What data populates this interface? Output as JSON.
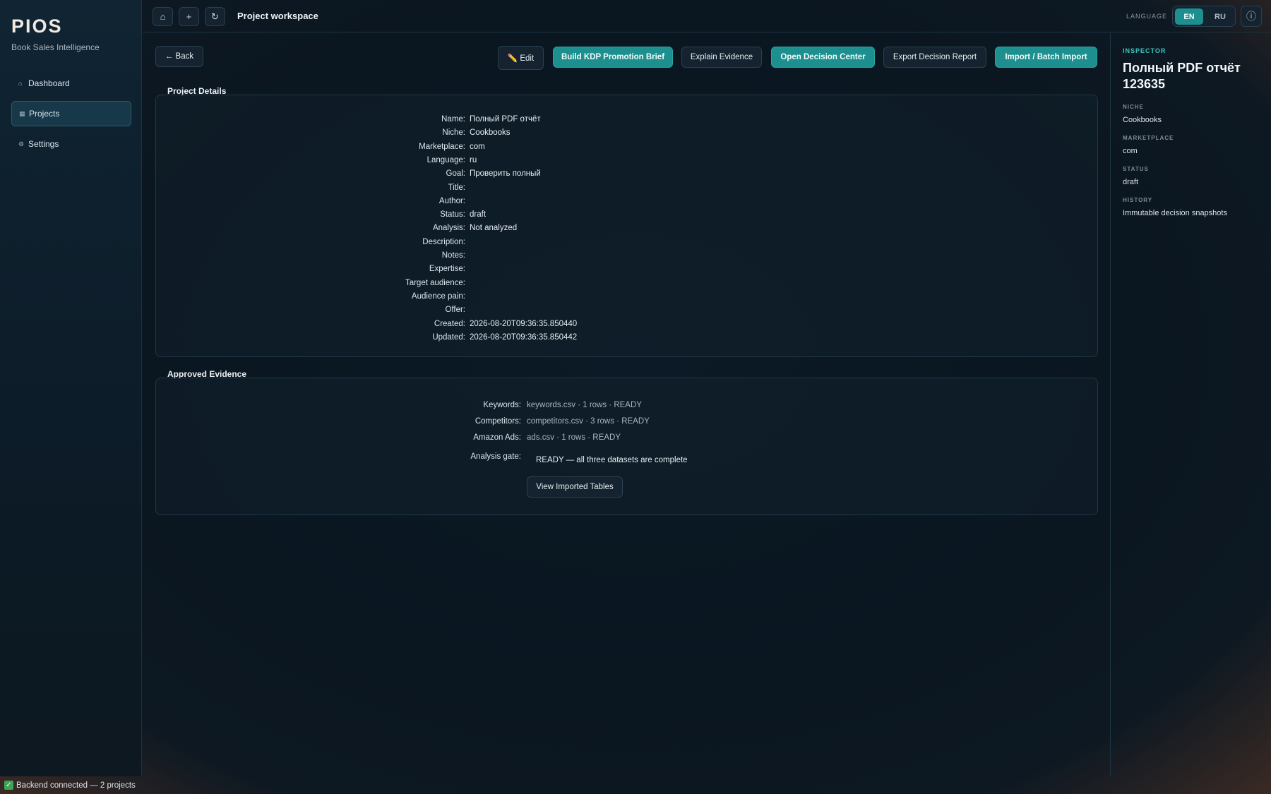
{
  "app": {
    "brand": "PIOS",
    "subtitle": "Book Sales Intelligence"
  },
  "sidebar": {
    "items": [
      {
        "label": "Dashboard",
        "icon": "house-icon",
        "glyph": "⌂"
      },
      {
        "label": "Projects",
        "icon": "grid-icon",
        "glyph": "▦"
      },
      {
        "label": "Settings",
        "icon": "gear-icon",
        "glyph": "⚙"
      }
    ]
  },
  "topbar": {
    "home_glyph": "⌂",
    "add_glyph": "+",
    "refresh_glyph": "↻",
    "title": "Project workspace",
    "language_label": "LANGUAGE",
    "lang_en": "EN",
    "lang_ru": "RU",
    "info_glyph": "ⓘ"
  },
  "toolbar": {
    "back": "← Back",
    "edit": "✏️ Edit",
    "build_brief": "Build KDP Promotion Brief",
    "explain_evidence": "Explain Evidence",
    "open_decision": "Open Decision Center",
    "export_report": "Export Decision Report",
    "import_batch": "Import / Batch Import"
  },
  "project_details": {
    "heading": "Project Details",
    "rows": [
      {
        "key": "Name:",
        "value": "Полный PDF отчёт"
      },
      {
        "key": "Niche:",
        "value": "Cookbooks"
      },
      {
        "key": "Marketplace:",
        "value": "com"
      },
      {
        "key": "Language:",
        "value": "ru"
      },
      {
        "key": "Goal:",
        "value": "Проверить полный"
      },
      {
        "key": "Title:",
        "value": ""
      },
      {
        "key": "Author:",
        "value": ""
      },
      {
        "key": "Status:",
        "value": "draft"
      },
      {
        "key": "Analysis:",
        "value": "Not analyzed"
      },
      {
        "key": "Description:",
        "value": ""
      },
      {
        "key": "Notes:",
        "value": ""
      },
      {
        "key": "Expertise:",
        "value": ""
      },
      {
        "key": "Target audience:",
        "value": ""
      },
      {
        "key": "Audience pain:",
        "value": ""
      },
      {
        "key": "Offer:",
        "value": ""
      },
      {
        "key": "Created:",
        "value": "2026-08-20T09:36:35.850440"
      },
      {
        "key": "Updated:",
        "value": "2026-08-20T09:36:35.850442"
      }
    ]
  },
  "evidence": {
    "heading": "Approved Evidence",
    "rows": [
      {
        "key": "Keywords:",
        "value": "keywords.csv · 1 rows · READY"
      },
      {
        "key": "Competitors:",
        "value": "competitors.csv · 3 rows · READY"
      },
      {
        "key": "Amazon Ads:",
        "value": "ads.csv · 1 rows · READY"
      }
    ],
    "gate_key": "Analysis gate:",
    "gate_value": "READY — all three datasets are complete",
    "view_tables": "View Imported Tables"
  },
  "inspector": {
    "tag": "INSPECTOR",
    "title": "Полный PDF отчёт 123635",
    "fields": [
      {
        "label": "NICHE",
        "value": "Cookbooks"
      },
      {
        "label": "MARKETPLACE",
        "value": "com"
      },
      {
        "label": "STATUS",
        "value": "draft"
      },
      {
        "label": "HISTORY",
        "value": "Immutable decision snapshots"
      }
    ]
  },
  "status": {
    "check_glyph": "✓",
    "text": "Backend connected — 2 projects"
  },
  "colors": {
    "accent": "#1d8f8f",
    "accent_text": "#3ec7c0",
    "ok": "#3aa657"
  }
}
